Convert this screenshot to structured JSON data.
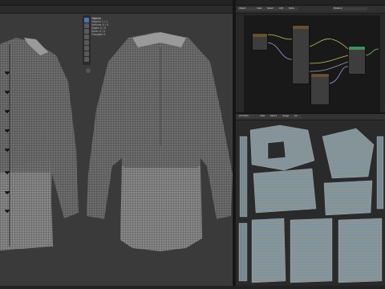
{
  "viewport": {
    "stats": {
      "title": "Objects",
      "lines": [
        "Objects 1 / 1",
        "Vertices 0 / 0",
        "Edges 0 / 0",
        "Faces 0 / 0",
        "Triangles 0"
      ]
    },
    "tools": [
      "select-tool",
      "cursor-tool",
      "move-tool",
      "rotate-tool",
      "scale-tool",
      "transform-tool",
      "annotate-tool",
      "measure-tool"
    ]
  },
  "node_editor": {
    "header_fields": [
      "Object",
      "View",
      "Select",
      "Add",
      "Node",
      "Material"
    ],
    "material_name": "Material"
  },
  "uv_editor": {
    "header_fields": [
      "UV Editor",
      "View",
      "Select",
      "Image",
      "UV"
    ]
  },
  "status_bar": {
    "text": ""
  },
  "colors": {
    "accent": "#4a76b8",
    "uv_island_fill": "#5a7f9a",
    "uv_island_stripe_warm": "#b4876a",
    "node_green": "#3f8f5a",
    "node_header": "#5f4b2f"
  }
}
